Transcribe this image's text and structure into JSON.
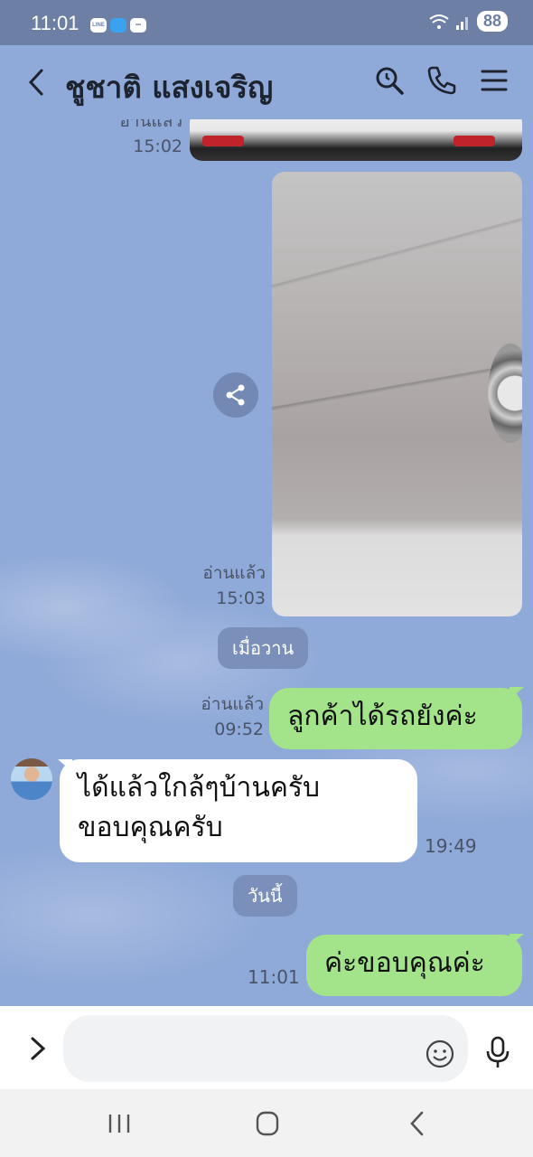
{
  "status_bar": {
    "time": "11:01",
    "battery": "88",
    "app_icons": [
      "LINE",
      "",
      ""
    ]
  },
  "header": {
    "title": "ชูชาติ แสงเจริญ",
    "icons": [
      "back-icon",
      "search-icon",
      "phone-icon",
      "menu-icon"
    ]
  },
  "messages": [
    {
      "type": "image",
      "direction": "out",
      "read_label": "อ่านแล้ว",
      "time": "15:02"
    },
    {
      "type": "image",
      "direction": "out",
      "read_label": "อ่านแล้ว",
      "time": "15:03"
    },
    {
      "type": "date",
      "label": "เมื่อวาน"
    },
    {
      "type": "text",
      "direction": "out",
      "text": "ลูกค้าได้รถยังค่ะ",
      "read_label": "อ่านแล้ว",
      "time": "09:52"
    },
    {
      "type": "text",
      "direction": "in",
      "line1": "ได้แล้วใกล้ๆบ้านครับ",
      "line2": "ขอบคุณครับ",
      "time": "19:49"
    },
    {
      "type": "date",
      "label": "วันนี้"
    },
    {
      "type": "text",
      "direction": "out",
      "text": "ค่ะขอบคุณค่ะ",
      "time": "11:01"
    }
  ],
  "input": {
    "placeholder": "",
    "value": ""
  },
  "colors": {
    "background": "#8fa9d8",
    "outgoing_bubble": "#a3e389",
    "incoming_bubble": "#ffffff",
    "date_pill": "#7a90ba",
    "status_bar": "#6e7fa6"
  }
}
